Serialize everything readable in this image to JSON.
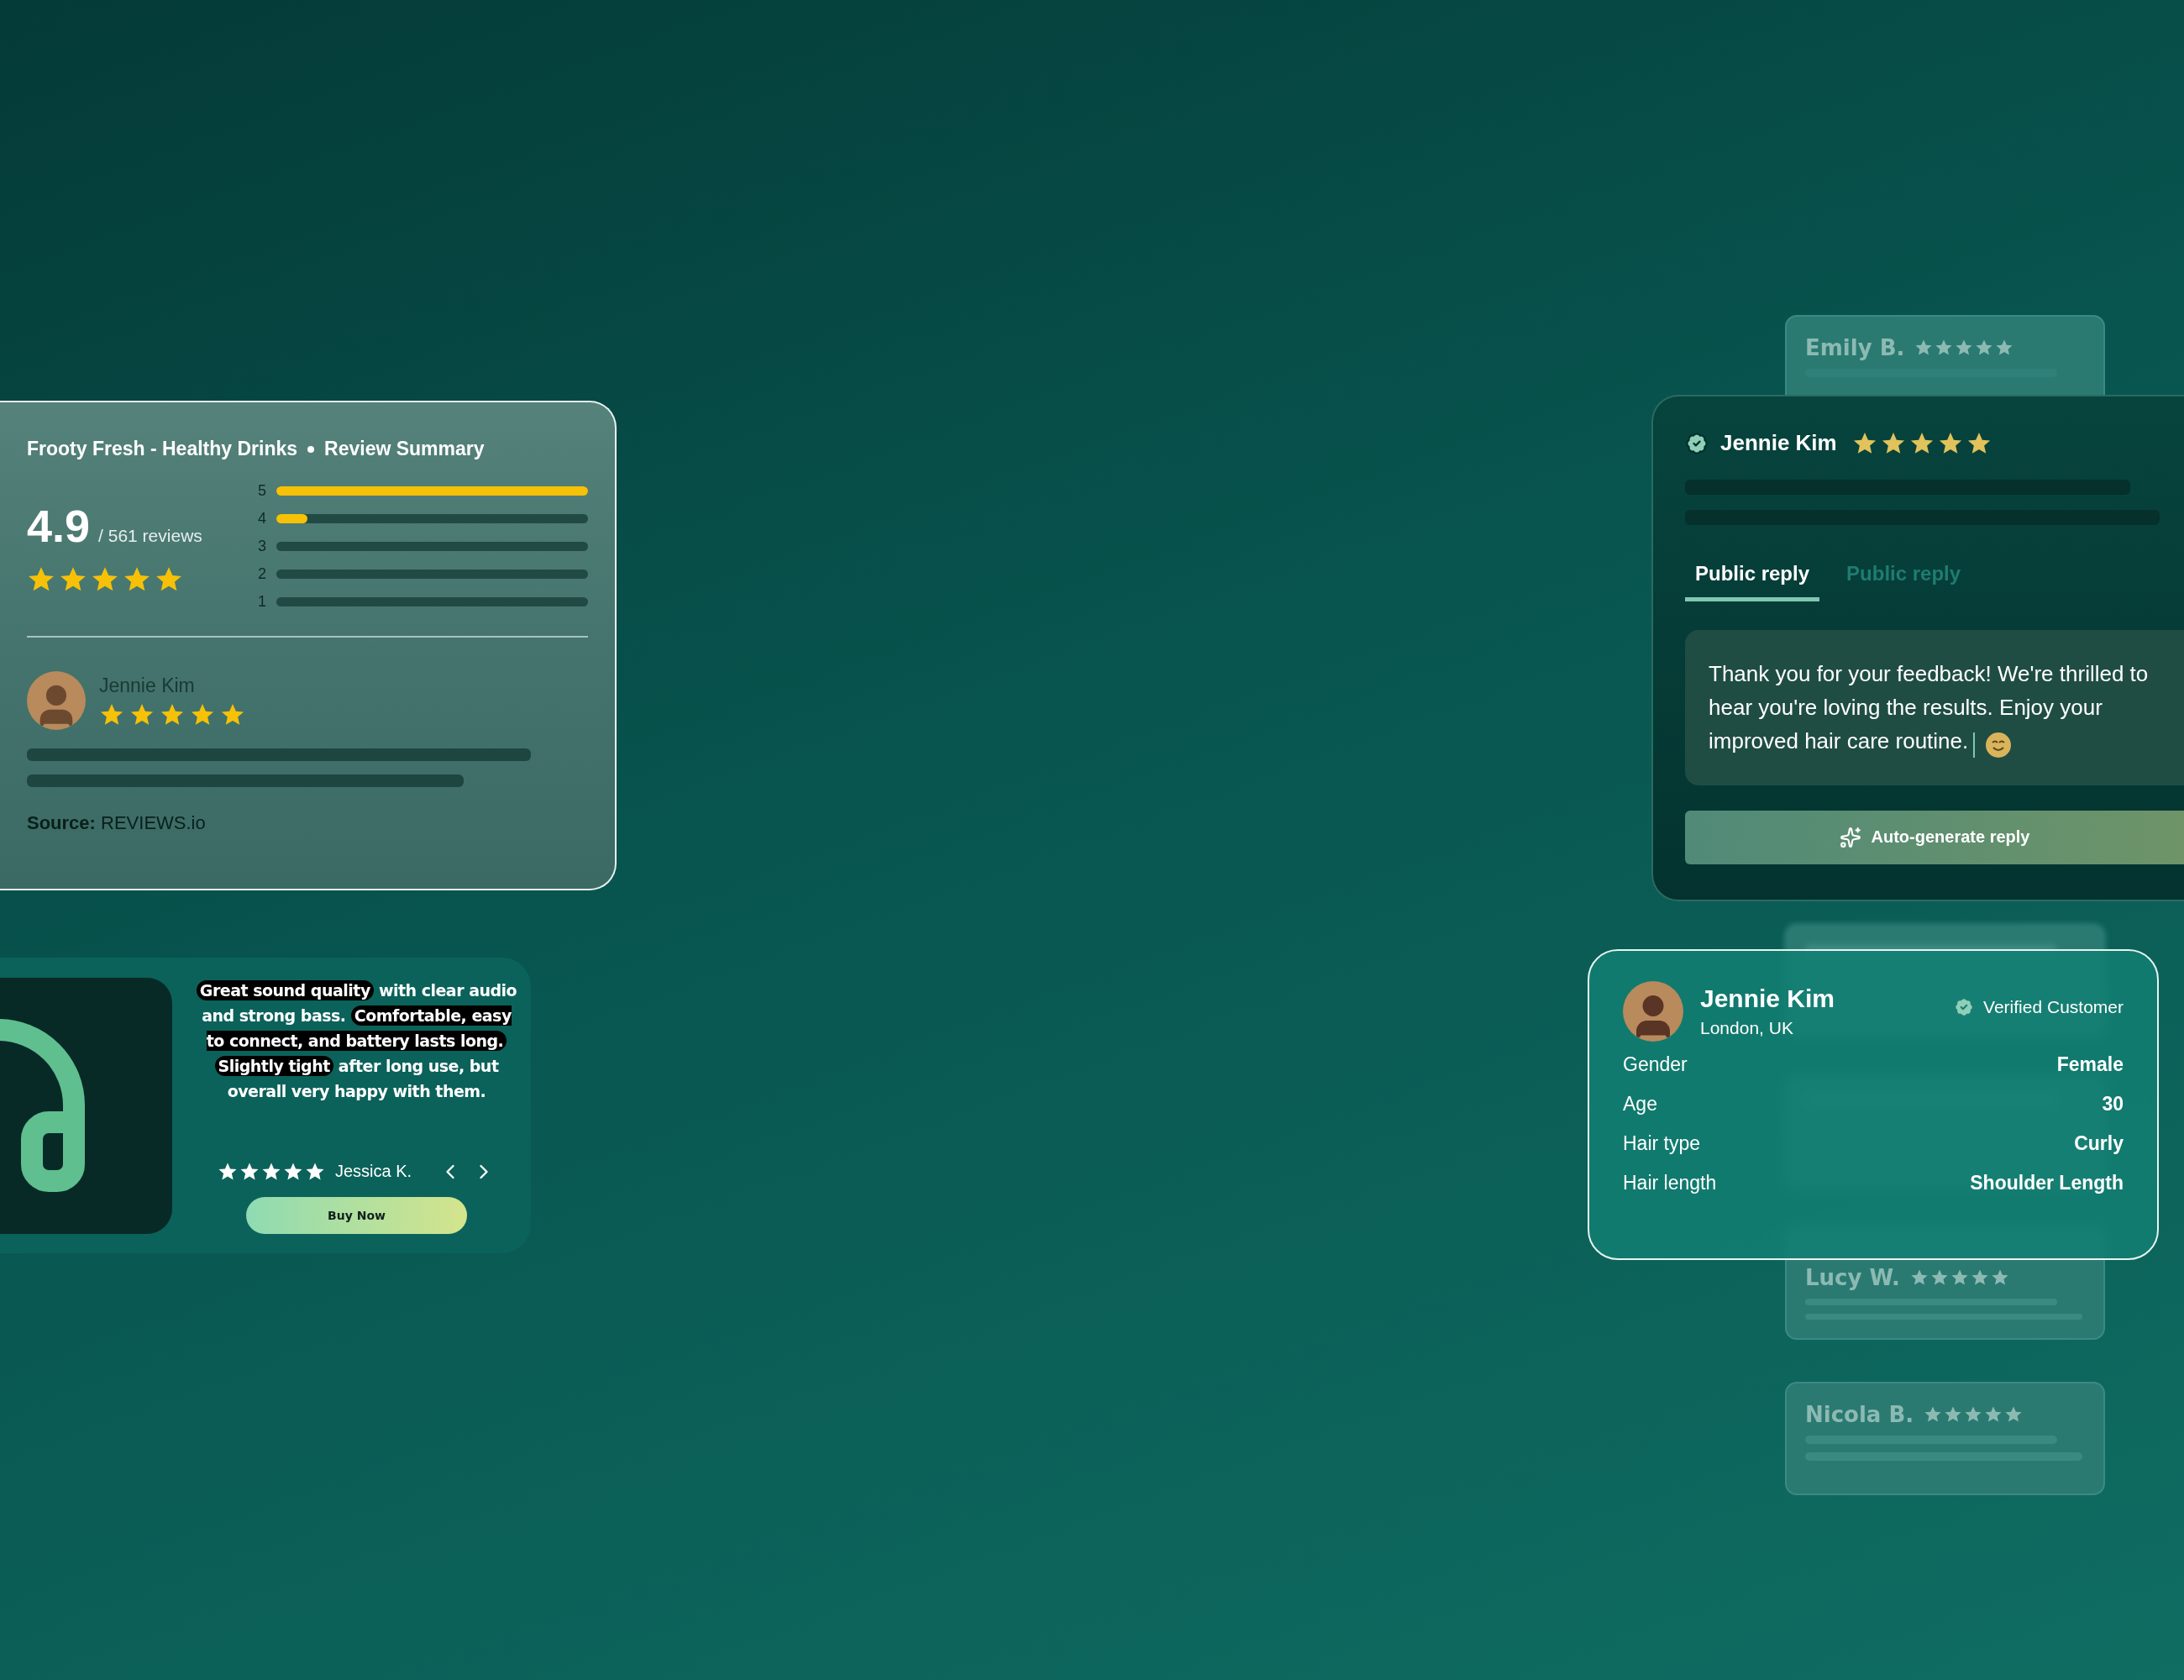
{
  "summary_card": {
    "product": "Frooty Fresh - Healthy Drinks",
    "section": "Review Summary",
    "score": "4.9",
    "review_count": "/ 561 reviews",
    "stars": 5,
    "rating_bars": [
      {
        "label": "5",
        "level": 1
      },
      {
        "label": "4",
        "level": 0.1
      },
      {
        "label": "3"
      },
      {
        "label": "2"
      },
      {
        "label": "1"
      }
    ],
    "reviewer": {
      "name": "Jennie Kim",
      "stars": 5
    },
    "source": "**Source:** REVIEWS.io"
  },
  "product_review_card": {
    "quote": "**Great sound quality** with clear audio and strong bass. **Comfortable, easy to connect, and battery lasts long.** **Slightly tight** after long use, but overall very happy with them.",
    "stars": 5,
    "author": "Jessica K.",
    "button": "Buy Now"
  },
  "back_review_card": {
    "name": "Emily B.",
    "stars": 5
  },
  "reply_card": {
    "name": "Jennie Kim",
    "verified": true,
    "stars": 5,
    "tabs": [
      {
        "label": "Public reply",
        "selected": true
      },
      {
        "label": "Public reply",
        "selected": false
      }
    ],
    "reply_text": "Thank you for your feedback! We're thrilled to hear you're loving the results. Enjoy your improved hair care routine.",
    "button": "Auto-generate reply"
  },
  "blurred_cards": [
    {
      "kind": "blurred"
    },
    {
      "kind": "blurred"
    },
    {
      "kind": "review",
      "name": "Lucy W.",
      "stars": 5
    },
    {
      "kind": "review",
      "name": "Nicola B.",
      "stars": 5
    }
  ],
  "profile_card": {
    "name": "Jennie Kim",
    "location": "London, UK",
    "badge": "Verified Customer",
    "attributes": [
      {
        "label": "Gender",
        "value": "Female"
      },
      {
        "label": "Age",
        "value": "30"
      },
      {
        "label": "Hair type",
        "value": "Curly"
      },
      {
        "label": "Hair length",
        "value": "Shoulder Length"
      }
    ]
  }
}
